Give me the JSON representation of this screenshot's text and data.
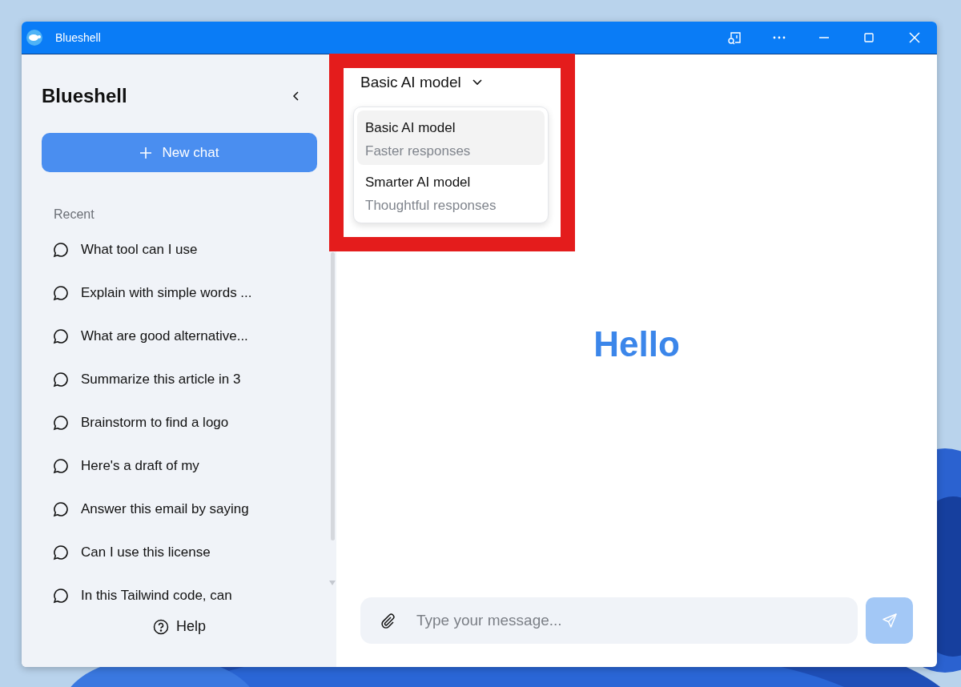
{
  "window": {
    "title": "Blueshell"
  },
  "sidebar": {
    "title": "Blueshell",
    "new_chat": "New chat",
    "section_label": "Recent",
    "items": [
      {
        "label": "What tool can I use"
      },
      {
        "label": "Explain with simple words ..."
      },
      {
        "label": "What are good alternative..."
      },
      {
        "label": "Summarize this article in 3"
      },
      {
        "label": "Brainstorm to find a logo"
      },
      {
        "label": "Here's a draft of my"
      },
      {
        "label": "Answer this email by saying"
      },
      {
        "label": "Can I use this license"
      },
      {
        "label": "In this Tailwind code, can"
      }
    ],
    "help": "Help"
  },
  "model_picker": {
    "label": "Basic AI model",
    "expanded": true,
    "options": [
      {
        "name": "Basic AI model",
        "description": "Faster responses",
        "selected": true
      },
      {
        "name": "Smarter AI model",
        "description": "Thoughtful responses",
        "selected": false
      }
    ]
  },
  "greeting": "Hello",
  "composer": {
    "placeholder": "Type your message..."
  }
}
